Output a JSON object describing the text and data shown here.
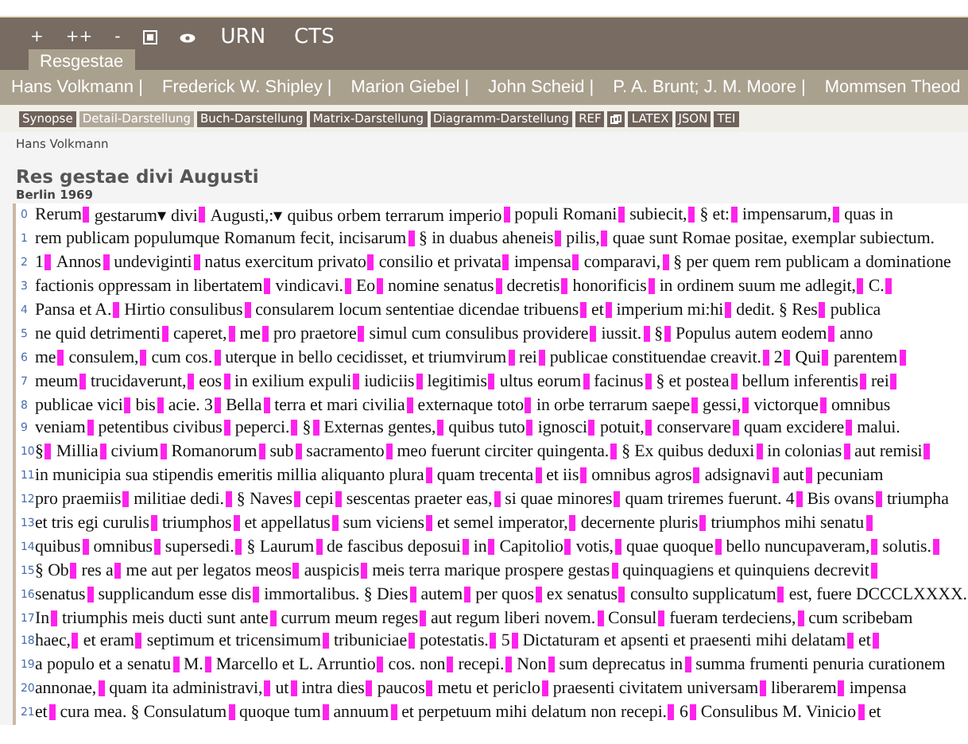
{
  "toolbar": [
    {
      "kind": "text",
      "label": "+"
    },
    {
      "kind": "text",
      "label": "++"
    },
    {
      "kind": "text",
      "label": "-"
    },
    {
      "kind": "frame"
    },
    {
      "kind": "eye"
    },
    {
      "kind": "text",
      "label": "URN"
    },
    {
      "kind": "text",
      "label": "CTS"
    }
  ],
  "tabs": [
    {
      "label": "Resgestae",
      "selected": true
    }
  ],
  "authors": [
    "Hans Volkmann |",
    "Frederick W. Shipley |",
    "Marion Giebel |",
    "John Scheid |",
    "P. A. Brunt; J. M. Moore |",
    "Mommsen Theod"
  ],
  "views": [
    {
      "kind": "text",
      "label": "Synopse",
      "selected": false
    },
    {
      "kind": "text",
      "label": "Detail-Darstellung",
      "selected": true
    },
    {
      "kind": "text",
      "label": "Buch-Darstellung",
      "selected": false
    },
    {
      "kind": "text",
      "label": "Matrix-Darstellung",
      "selected": false
    },
    {
      "kind": "text",
      "label": "Diagramm-Darstellung",
      "selected": false
    },
    {
      "kind": "text",
      "label": "REF",
      "selected": false
    },
    {
      "kind": "icon",
      "selected": false
    },
    {
      "kind": "text",
      "label": "LATEX",
      "selected": false
    },
    {
      "kind": "text",
      "label": "JSON",
      "selected": false
    },
    {
      "kind": "text",
      "label": "TEI",
      "selected": false
    }
  ],
  "document": {
    "translator": "Hans Volkmann",
    "title": "Res gestae divi Augusti",
    "imprint": "Berlin 1969",
    "lines": [
      {
        "number": "0",
        "segments": [
          "Rerum",
          "gestarum▾ divi",
          "Augusti,:▾ quibus orbem terrarum imperio",
          "populi Romani",
          "subiecit,",
          "§ et:",
          "impensarum,",
          "quas in"
        ],
        "end_mark": false
      },
      {
        "number": "1",
        "segments": [
          "rem publicam populumque Romanum fecit, incisarum",
          "§ in duabus aheneis",
          "pilis,",
          "quae sunt Romae positae, exemplar subiectum."
        ],
        "end_mark": false
      },
      {
        "number": "2",
        "segments": [
          "1",
          "Annos",
          "undeviginti",
          "natus exercitum privato",
          "consilio et privata",
          "impensa",
          "comparavi,",
          "§ per quem rem publicam a dominatione"
        ],
        "end_mark": false
      },
      {
        "number": "3",
        "segments": [
          "factionis oppressam in libertatem",
          "vindicavi.",
          "Eo",
          "nomine senatus",
          "decretis",
          "honorificis",
          "in ordinem suum me adlegit,",
          "C."
        ],
        "end_mark": true
      },
      {
        "number": "4",
        "segments": [
          "Pansa et A.",
          "Hirtio consulibus",
          "consularem locum sententiae dicendae tribuens",
          "et",
          "imperium mi:hi",
          "dedit. § Res",
          "publica"
        ],
        "end_mark": false
      },
      {
        "number": "5",
        "segments": [
          "ne quid detrimenti",
          "caperet,",
          "me",
          "pro praetore",
          "simul cum consulibus providere",
          "iussit.",
          "§",
          "Populus autem eodem",
          "anno"
        ],
        "end_mark": false
      },
      {
        "number": "6",
        "segments": [
          "me",
          "consulem,",
          "cum cos.",
          "uterque in bello cecidisset, et triumvirum",
          "rei",
          "publicae constituendae creavit.",
          "2",
          "Qui",
          "parentem"
        ],
        "end_mark": true
      },
      {
        "number": "7",
        "segments": [
          "meum",
          "trucidaverunt,",
          "eos",
          "in exilium expuli",
          "iudiciis",
          "legitimis",
          "ultus eorum",
          "facinus",
          "§ et postea",
          "bellum inferentis",
          "rei"
        ],
        "end_mark": true
      },
      {
        "number": "8",
        "segments": [
          "publicae vici",
          "bis",
          "acie. 3",
          "Bella",
          "terra et mari civilia",
          "externaque toto",
          "in orbe terrarum saepe",
          "gessi,",
          "victorque",
          "omnibus"
        ],
        "end_mark": false
      },
      {
        "number": "9",
        "segments": [
          "veniam",
          "petentibus civibus",
          "peperci.",
          "§",
          "Externas gentes,",
          "quibus tuto",
          "ignosci",
          "potuit,",
          "conservare",
          "quam excidere",
          "malui."
        ],
        "end_mark": false
      },
      {
        "number": "10",
        "segments": [
          "§",
          "Millia",
          "civium",
          "Romanorum",
          "sub",
          "sacramento",
          "meo fuerunt circiter quingenta.",
          "§ Ex quibus deduxi",
          "in colonias",
          "aut remisi"
        ],
        "end_mark": true
      },
      {
        "number": "11",
        "segments": [
          "in municipia sua stipendis emeritis millia aliquanto plura",
          "quam trecenta",
          "et iis",
          "omnibus agros",
          "adsignavi",
          "aut",
          "pecuniam"
        ],
        "end_mark": false
      },
      {
        "number": "12",
        "segments": [
          "pro praemiis",
          "militiae dedi.",
          "§ Naves",
          "cepi",
          "sescentas praeter eas,",
          "si quae minores",
          "quam triremes fuerunt. 4",
          "Bis ovans",
          "triumpha"
        ],
        "end_mark": false
      },
      {
        "number": "13",
        "segments": [
          "et tris egi curulis",
          "triumphos",
          "et appellatus",
          "sum viciens",
          "et semel imperator,",
          "decernente pluris",
          "triumphos mihi senatu"
        ],
        "end_mark": true
      },
      {
        "number": "14",
        "segments": [
          "quibus",
          "omnibus",
          "supersedi.",
          "§ Laurum",
          "de fascibus deposui",
          "in",
          "Capitolio",
          "votis,",
          "quae quoque",
          "bello nuncupaveram,",
          "solutis."
        ],
        "end_mark": true
      },
      {
        "number": "15",
        "segments": [
          "§ Ob",
          "res a",
          "me aut per legatos meos",
          "auspicis",
          "meis terra marique prospere gestas",
          "quinquagiens et quinquiens decrevit"
        ],
        "end_mark": true
      },
      {
        "number": "16",
        "segments": [
          "senatus",
          "supplicandum esse dis",
          "immortalibus. § Dies",
          "autem",
          "per quos",
          "ex senatus",
          "consulto supplicatum",
          "est, fuere DCCCLXXXX."
        ],
        "end_mark": false
      },
      {
        "number": "17",
        "segments": [
          "In",
          "triumphis meis ducti sunt ante",
          "currum meum reges",
          "aut regum liberi novem.",
          "Consul",
          "fueram terdeciens,",
          "cum scribebam"
        ],
        "end_mark": false
      },
      {
        "number": "18",
        "segments": [
          "haec,",
          "et eram",
          "septimum et tricensimum",
          "tribuniciae",
          "potestatis.",
          "5",
          "Dictaturam et apsenti et praesenti mihi delatam",
          "et"
        ],
        "end_mark": true
      },
      {
        "number": "19",
        "segments": [
          "a populo et a senatu",
          "M.",
          "Marcello et L. Arruntio",
          "cos. non",
          "recepi.",
          "Non",
          "sum deprecatus in",
          "summa frumenti penuria curationem"
        ],
        "end_mark": false
      },
      {
        "number": "20",
        "segments": [
          "annonae,",
          "quam ita administravi,",
          "ut",
          "intra dies",
          "paucos",
          "metu et periclo",
          "praesenti civitatem universam",
          "liberarem",
          "impensa"
        ],
        "end_mark": false
      },
      {
        "number": "21",
        "segments": [
          "et",
          "cura mea. § Consulatum",
          "quoque tum",
          "annuum",
          "et perpetuum mihi delatum non recepi.",
          "6",
          "Consulibus M. Vinicio",
          "et"
        ],
        "end_mark": false
      }
    ]
  }
}
